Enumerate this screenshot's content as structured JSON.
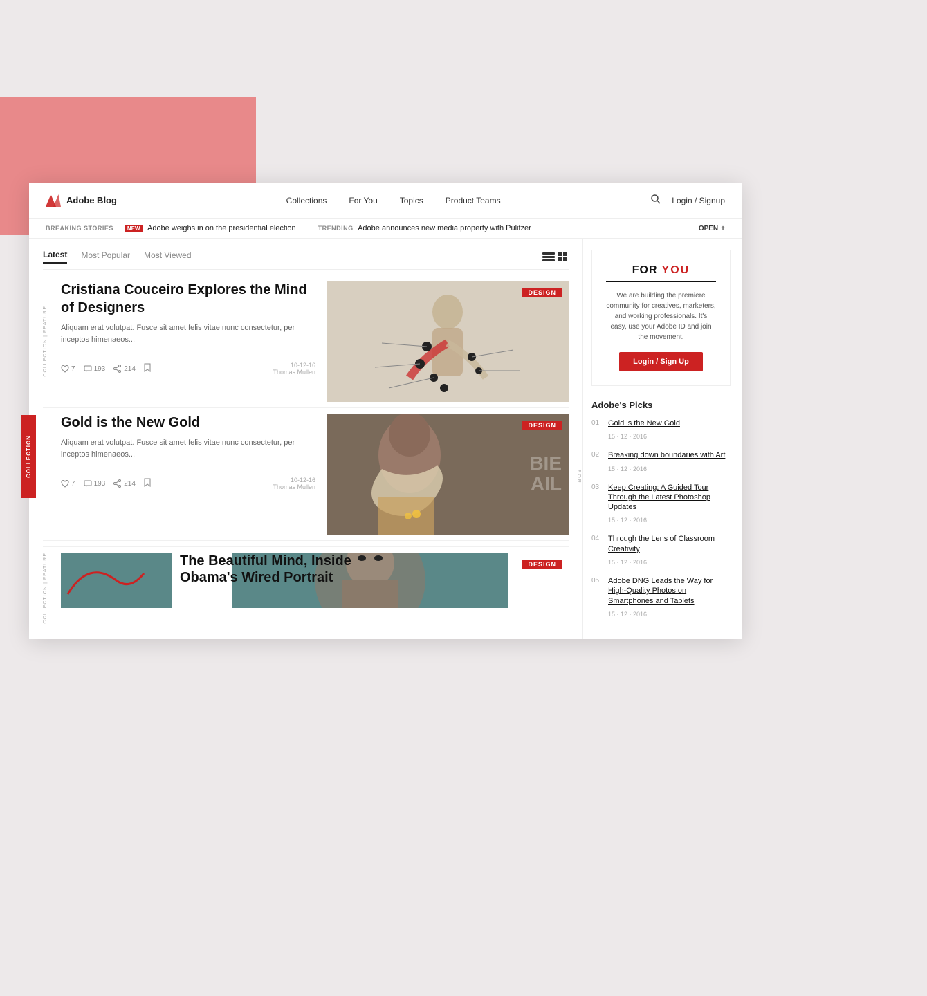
{
  "page": {
    "background": "#ede9ea",
    "pink_block": {
      "visible": true
    }
  },
  "header": {
    "logo_text": "Adobe Blog",
    "nav_items": [
      {
        "label": "Collections"
      },
      {
        "label": "For You"
      },
      {
        "label": "Topics"
      },
      {
        "label": "Product Teams"
      }
    ],
    "search_icon": "🔍",
    "login_text": "Login / Signup"
  },
  "breaking_bar": {
    "label": "Breaking Stories",
    "new_badge": "NEW",
    "story1": "Adobe weighs in on the presidential election",
    "trending_label": "TRENDING",
    "story2": "Adobe announces new media property with Pulitzer",
    "open_btn": "OPEN",
    "plus_icon": "+"
  },
  "tabs": [
    {
      "label": "Latest",
      "active": true
    },
    {
      "label": "Most Popular",
      "active": false
    },
    {
      "label": "Most Viewed",
      "active": false
    }
  ],
  "articles": [
    {
      "id": 1,
      "side_label": "COLLECTION | FEATURE",
      "title": "Cristiana Couceiro Explores the Mind of Designers",
      "excerpt": "Aliquam erat volutpat. Fusce sit amet felis vitae nunc consectetur, per inceptos himenaeos...",
      "likes": "7",
      "comments": "193",
      "shares": "214",
      "date": "10-12-16",
      "author": "Thomas Mullen",
      "badge": "DESIGN",
      "overlay": ""
    },
    {
      "id": 2,
      "side_label": "",
      "title": "Gold is the New Gold",
      "excerpt": "Aliquam erat volutpat. Fusce sit amet felis vitae nunc consectetur, per inceptos himenaeos...",
      "likes": "7",
      "comments": "193",
      "shares": "214",
      "date": "10-12-16",
      "author": "Thomas Mullen",
      "badge": "DESIGN",
      "overlay": "BIE\nAIL"
    },
    {
      "id": 3,
      "side_label": "COLLECTION | FEATURE",
      "title": "The Beautiful Mind, Inside Obama's Wired Portrait",
      "excerpt": "",
      "badge": "DESIGN"
    }
  ],
  "for_you": {
    "for_text": "FOR",
    "you_text": "YOU",
    "description": "We are building the premiere community for creatives, marketers, and working professionals.  It's easy, use your Adobe ID and join the movement.",
    "btn_label": "Login / Sign Up"
  },
  "adobes_picks": {
    "title": "Adobe's Picks",
    "items": [
      {
        "number": "01",
        "link": "Gold is the New Gold",
        "date": "15 · 12 · 2016"
      },
      {
        "number": "02",
        "link": "Breaking down boundaries with Art",
        "date": "15 · 12 · 2016"
      },
      {
        "number": "03",
        "link": "Keep Creating: A Guided Tour Through the Latest Photoshop Updates",
        "date": "15 · 12 · 2016"
      },
      {
        "number": "04",
        "link": "Through the Lens of Classroom Creativity",
        "date": "15 · 12 · 2016"
      },
      {
        "number": "05",
        "link": "Adobe DNG Leads the Way for High-Quality Photos on Smartphones and Tablets",
        "date": "15 · 12 · 2016"
      }
    ]
  }
}
